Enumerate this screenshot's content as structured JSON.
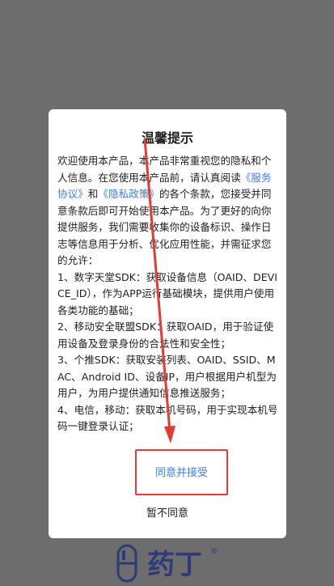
{
  "dialog": {
    "title": "温馨提示",
    "paragraphs": [
      [
        "欢迎使用本产品，本产品非常重视您的隐私和个人信息。在您使用本产品前，请认真阅读",
        "《服务协议》",
        "和",
        "《隐私政策》",
        "的各个条款，您接受并同意条款后即可开始使用本产品。为了更好的向你提供服务，我们需要收集你的设备标识、操作日志等信息用于分析、优化应用性能，并需征求您的允许："
      ],
      [
        "1、数字天堂SDK：获取设备信息（OAID、DEVICE_ID），作为APP运行基础模块，提供用户使用各类功能的基础；"
      ],
      [
        "2、移动安全联盟SDK：获取OAID，用于验证使用设备及登录身份的合法性和安全性；"
      ],
      [
        "3、个推SDK：获取安装列表、OAID、SSID、MAC、Android ID、设备IP，用户根据用户机型为用户，为用户提供通知信息推送服务；"
      ],
      [
        "4、电信，移动：获取本机号码，用于实现本机号码一键登录认证；"
      ]
    ],
    "agree_label": "同意并接受",
    "reject_label": "暂不同意"
  },
  "logo": {
    "text": "药丁",
    "registered": "®"
  },
  "colors": {
    "link": "#3d7ef0",
    "highlight_border": "#e53b35",
    "arrow": "#e53b35",
    "logo": "#2d3c78"
  }
}
